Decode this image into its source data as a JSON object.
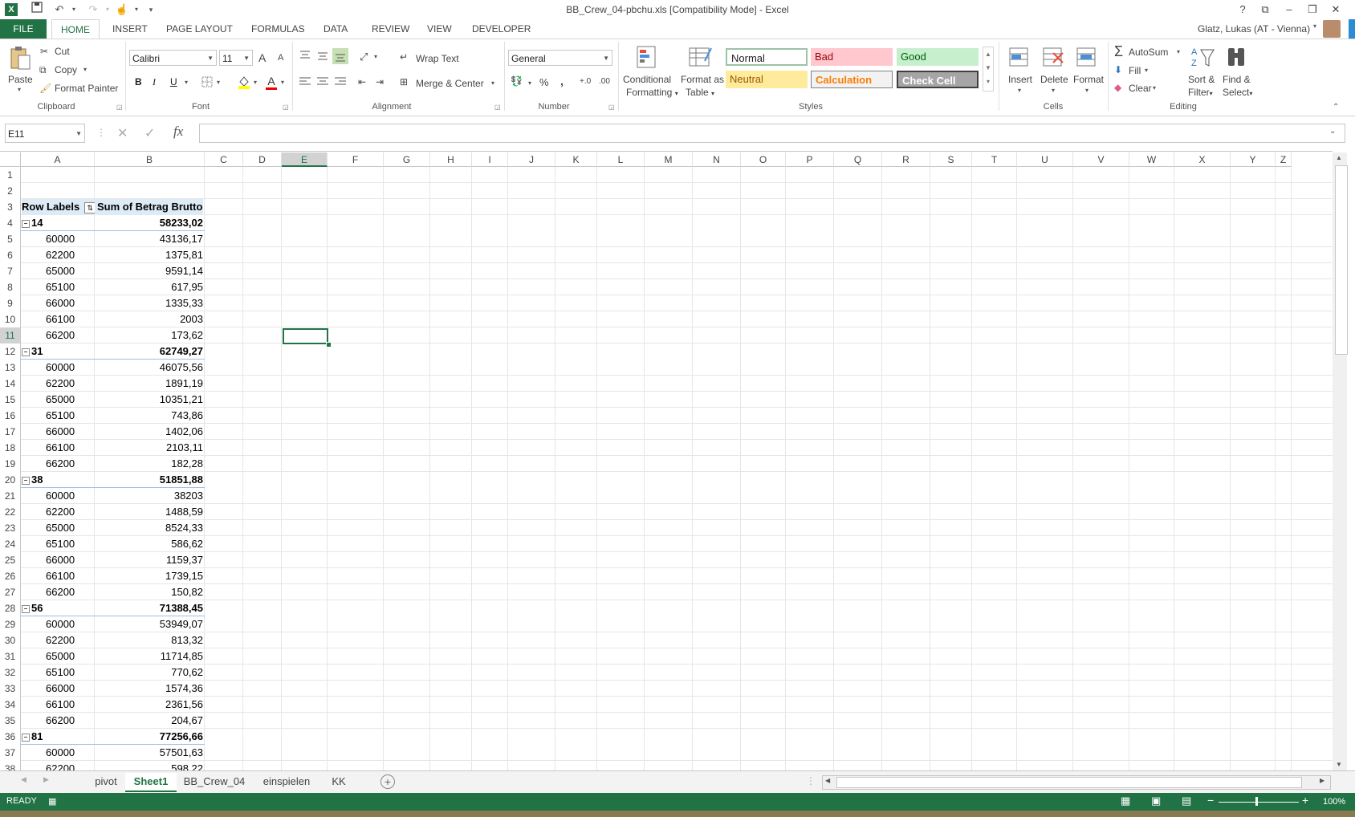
{
  "window": {
    "title": "BB_Crew_04-pbchu.xls  [Compatibility Mode] - Excel",
    "help": "?",
    "minimize": "–",
    "restore": "❐",
    "close": "✕",
    "ribbon_display": "⧉"
  },
  "tabs": [
    "FILE",
    "HOME",
    "INSERT",
    "PAGE LAYOUT",
    "FORMULAS",
    "DATA",
    "REVIEW",
    "VIEW",
    "DEVELOPER"
  ],
  "user": "Glatz, Lukas (AT - Vienna)",
  "clipboard": {
    "paste": "Paste",
    "cut": "Cut",
    "copy": "Copy",
    "format_painter": "Format Painter",
    "group": "Clipboard"
  },
  "font": {
    "name": "Calibri",
    "size": "11",
    "bold": "B",
    "italic": "I",
    "underline": "U",
    "grow": "A",
    "shrink": "A",
    "group": "Font",
    "font_color_glyph": "A"
  },
  "alignment": {
    "wrap": "Wrap Text",
    "merge": "Merge & Center",
    "group": "Alignment"
  },
  "number": {
    "format": "General",
    "percent": "%",
    "comma": ",",
    "group": "Number",
    "inc": "+.0",
    "dec": ".00"
  },
  "styles": {
    "conditional": "Conditional",
    "conditional2": "Formatting",
    "format_table": "Format as",
    "format_table2": "Table",
    "normal": "Normal",
    "bad": "Bad",
    "good": "Good",
    "neutral": "Neutral",
    "calculation": "Calculation",
    "check_cell": "Check Cell",
    "group": "Styles"
  },
  "cells": {
    "insert": "Insert",
    "delete": "Delete",
    "format": "Format",
    "group": "Cells"
  },
  "editing": {
    "autosum": "AutoSum",
    "fill": "Fill",
    "clear": "Clear",
    "sort": "Sort &",
    "sort2": "Filter",
    "find": "Find &",
    "find2": "Select",
    "group": "Editing"
  },
  "formula_bar": {
    "name_box": "E11",
    "fx": "fx",
    "cancel": "✕",
    "enter": "✓",
    "value": ""
  },
  "columns": [
    "A",
    "B",
    "C",
    "D",
    "E",
    "F",
    "G",
    "H",
    "I",
    "J",
    "K",
    "L",
    "M",
    "N",
    "O",
    "P",
    "Q",
    "R",
    "S",
    "T",
    "U",
    "V",
    "W",
    "X",
    "Y",
    "Z"
  ],
  "rows": [
    {
      "n": "1",
      "a": "",
      "b": ""
    },
    {
      "n": "2",
      "a": "",
      "b": ""
    },
    {
      "n": "3",
      "a": "Row Labels",
      "b": "Sum of Betrag Brutto",
      "header": true
    },
    {
      "n": "4",
      "a": "14",
      "b": "58233,02",
      "group": true
    },
    {
      "n": "5",
      "a": "60000",
      "b": "43136,17"
    },
    {
      "n": "6",
      "a": "62200",
      "b": "1375,81"
    },
    {
      "n": "7",
      "a": "65000",
      "b": "9591,14"
    },
    {
      "n": "8",
      "a": "65100",
      "b": "617,95"
    },
    {
      "n": "9",
      "a": "66000",
      "b": "1335,33"
    },
    {
      "n": "10",
      "a": "66100",
      "b": "2003"
    },
    {
      "n": "11",
      "a": "66200",
      "b": "173,62"
    },
    {
      "n": "12",
      "a": "31",
      "b": "62749,27",
      "group": true
    },
    {
      "n": "13",
      "a": "60000",
      "b": "46075,56"
    },
    {
      "n": "14",
      "a": "62200",
      "b": "1891,19"
    },
    {
      "n": "15",
      "a": "65000",
      "b": "10351,21"
    },
    {
      "n": "16",
      "a": "65100",
      "b": "743,86"
    },
    {
      "n": "17",
      "a": "66000",
      "b": "1402,06"
    },
    {
      "n": "18",
      "a": "66100",
      "b": "2103,11"
    },
    {
      "n": "19",
      "a": "66200",
      "b": "182,28"
    },
    {
      "n": "20",
      "a": "38",
      "b": "51851,88",
      "group": true
    },
    {
      "n": "21",
      "a": "60000",
      "b": "38203"
    },
    {
      "n": "22",
      "a": "62200",
      "b": "1488,59"
    },
    {
      "n": "23",
      "a": "65000",
      "b": "8524,33"
    },
    {
      "n": "24",
      "a": "65100",
      "b": "586,62"
    },
    {
      "n": "25",
      "a": "66000",
      "b": "1159,37"
    },
    {
      "n": "26",
      "a": "66100",
      "b": "1739,15"
    },
    {
      "n": "27",
      "a": "66200",
      "b": "150,82"
    },
    {
      "n": "28",
      "a": "56",
      "b": "71388,45",
      "group": true
    },
    {
      "n": "29",
      "a": "60000",
      "b": "53949,07"
    },
    {
      "n": "30",
      "a": "62200",
      "b": "813,32"
    },
    {
      "n": "31",
      "a": "65000",
      "b": "11714,85"
    },
    {
      "n": "32",
      "a": "65100",
      "b": "770,62"
    },
    {
      "n": "33",
      "a": "66000",
      "b": "1574,36"
    },
    {
      "n": "34",
      "a": "66100",
      "b": "2361,56"
    },
    {
      "n": "35",
      "a": "66200",
      "b": "204,67"
    },
    {
      "n": "36",
      "a": "81",
      "b": "77256,66",
      "group": true
    },
    {
      "n": "37",
      "a": "60000",
      "b": "57501,63"
    },
    {
      "n": "38",
      "a": "62200",
      "b": "598,22"
    }
  ],
  "sheets": [
    "pivot",
    "Sheet1",
    "BB_Crew_04",
    "einspielen",
    "KK"
  ],
  "active_sheet": "Sheet1",
  "status": {
    "ready": "READY",
    "zoom": "100%"
  },
  "colors": {
    "accent": "#217346",
    "bad_bg": "#ffc7ce",
    "bad_fg": "#9c0006",
    "good_bg": "#c6efce",
    "good_fg": "#006100",
    "neutral_bg": "#ffeb9c",
    "neutral_fg": "#9c5700",
    "calc_bg": "#f2f2f2",
    "calc_fg": "#fa7d00",
    "check_bg": "#a5a5a5"
  }
}
